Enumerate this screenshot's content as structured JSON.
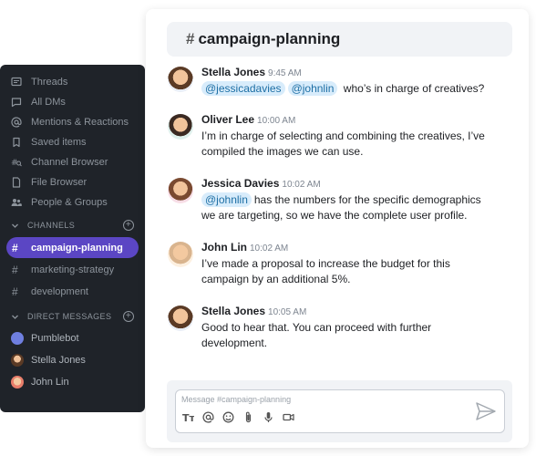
{
  "sidebar": {
    "nav": [
      {
        "label": "Threads",
        "icon": "threads-icon"
      },
      {
        "label": "All DMs",
        "icon": "dm-icon"
      },
      {
        "label": "Mentions & Reactions",
        "icon": "at-icon"
      },
      {
        "label": "Saved items",
        "icon": "bookmark-icon"
      },
      {
        "label": "Channel Browser",
        "icon": "channel-browser-icon"
      },
      {
        "label": "File Browser",
        "icon": "file-icon"
      },
      {
        "label": "People & Groups",
        "icon": "people-icon"
      }
    ],
    "channels_header": "CHANNELS",
    "channels": [
      "campaign-planning",
      "marketing-strategy",
      "development"
    ],
    "active_channel": "campaign-planning",
    "dm_header": "DIRECT MESSAGES",
    "dms": [
      {
        "name": "Pumblebot",
        "color": "#6f7fe0"
      },
      {
        "name": "Stella Jones",
        "color": "#c98b5a"
      },
      {
        "name": "John Lin",
        "color": "#e0a070"
      }
    ]
  },
  "channel": {
    "hash": "#",
    "name": "campaign-planning"
  },
  "messages": [
    {
      "name": "Stella Jones",
      "time": "9:45 AM",
      "mentions": [
        "@jessicadavies",
        "@johnlin"
      ],
      "text": " who’s in charge of creatives?"
    },
    {
      "name": "Oliver Lee",
      "time": "10:00 AM",
      "line1": "I’m in charge of selecting and combining the creatives, I’ve",
      "line2": "compiled the images we can use."
    },
    {
      "name": "Jessica Davies",
      "time": "10:02 AM",
      "mention": "@johnlin",
      "line1": "has the numbers for the specific demographics",
      "line2": "we are targeting, so we have the complete user profile."
    },
    {
      "name": "John Lin",
      "time": "10:02 AM",
      "line1": "I’ve made a proposal to increase the budget for this",
      "line2": "campaign by an additional 5%."
    },
    {
      "name": "Stella Jones",
      "time": "10:05 AM",
      "line1": "Good to hear that. You can proceed with further",
      "line2": "development."
    }
  ],
  "composer": {
    "placeholder": "Message #campaign-planning"
  },
  "colors": {
    "sidebar_bg": "#1f2329",
    "active_channel": "#5b46c4",
    "mention_bg": "#d8ecfb"
  }
}
